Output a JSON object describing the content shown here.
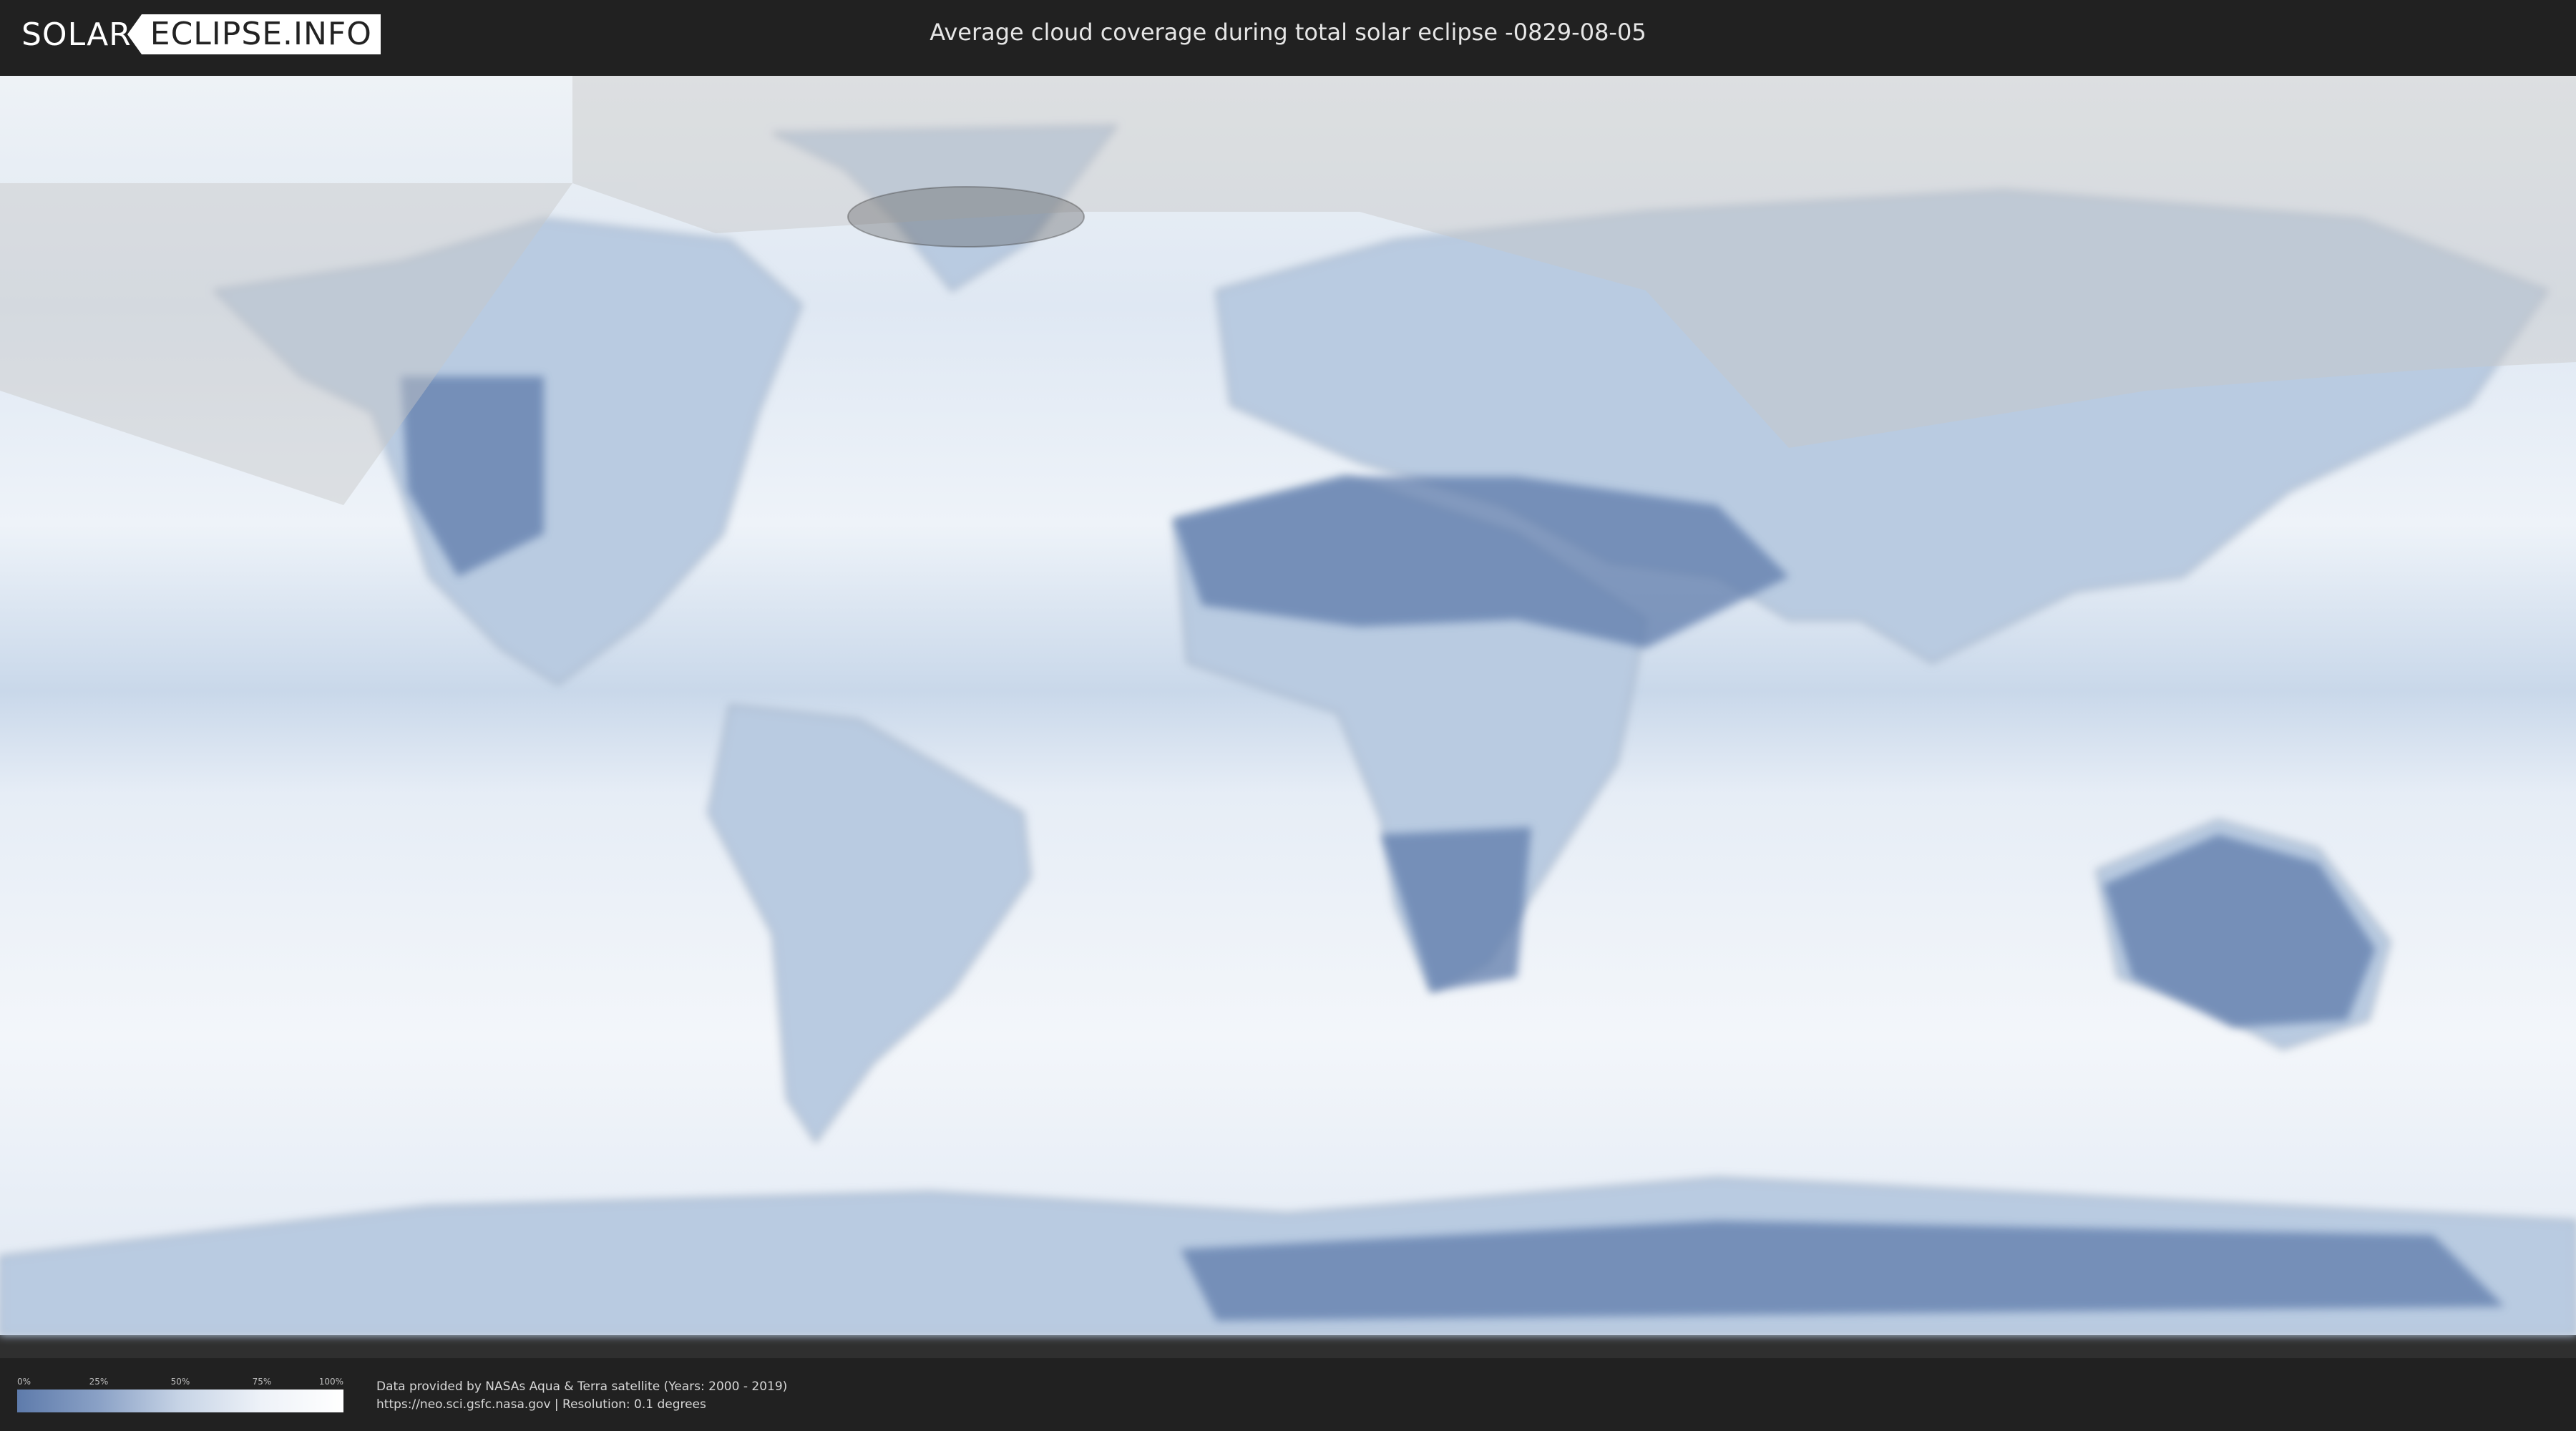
{
  "header": {
    "logo_left": "SOLAR",
    "logo_right": "ECLIPSE.INFO",
    "title": "Average cloud coverage during total solar eclipse -0829-08-05"
  },
  "legend": {
    "ticks": [
      "0%",
      "25%",
      "50%",
      "75%",
      "100%"
    ],
    "scale_colors": [
      "#5e7bab",
      "#8aa1c6",
      "#c7d4e6",
      "#eef2f8",
      "#ffffff"
    ]
  },
  "footer": {
    "credit_line1": "Data provided by NASAs Aqua & Terra satellite (Years: 2000 - 2019)",
    "credit_line2": "https://neo.sci.gsfc.nasa.gov | Resolution: 0.1 degrees"
  },
  "colors": {
    "clear_sky": "#5e7bab",
    "cloudy": "#ffffff",
    "shadow_zone": "#d9d9d9"
  }
}
